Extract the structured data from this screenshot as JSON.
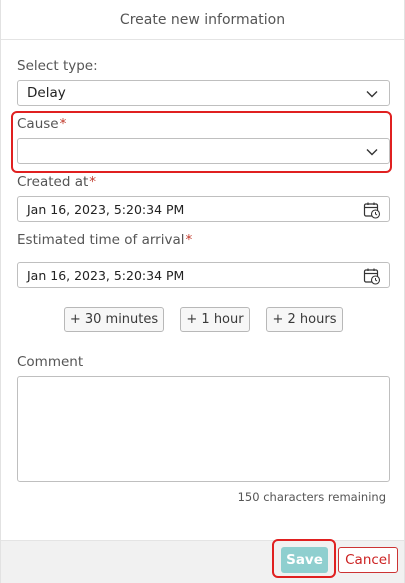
{
  "dialog": {
    "title": "Create new information"
  },
  "form": {
    "type_label": "Select type:",
    "type_value": "Delay",
    "cause_label": "Cause",
    "cause_value": "",
    "created_label": "Created at",
    "created_value": "Jan 16, 2023, 5:20:34 PM",
    "eta_label": "Estimated time of arrival",
    "eta_value": "Jan 16, 2023, 5:20:34 PM",
    "required_marker": "*",
    "quick_add": [
      "+ 30 minutes",
      "+ 1 hour",
      "+ 2 hours"
    ],
    "comment_label": "Comment",
    "comment_value": "",
    "remaining": "150 characters remaining"
  },
  "footer": {
    "save_label": "Save",
    "cancel_label": "Cancel"
  },
  "colors": {
    "required": "#c0392b",
    "highlight": "#e02020",
    "save": "#8fcfcf",
    "cancel": "#cc2222"
  },
  "icons": {
    "dropdown": "chevron-down-icon",
    "date": "calendar-clock-icon"
  }
}
